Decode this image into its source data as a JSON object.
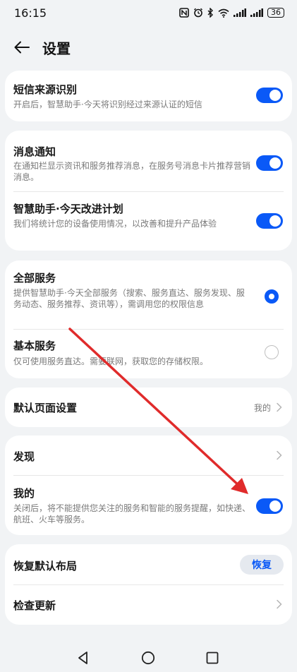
{
  "status_bar": {
    "time": "16:15",
    "icons": [
      "nfc-icon",
      "alarm-icon",
      "bluetooth-icon",
      "wifi-icon",
      "signal-icon",
      "signal-icon-2"
    ],
    "battery_level": "36"
  },
  "header": {
    "back_icon": "back-arrow-icon",
    "title": "设置"
  },
  "sms_card": {
    "title": "短信来源识别",
    "desc": "开启后，智慧助手·今天将识别经过来源认证的短信",
    "toggle_on": true
  },
  "notify_card": {
    "items": [
      {
        "title": "消息通知",
        "desc": "在通知栏显示资讯和服务推荐消息，在服务号消息卡片推荐营销消息。",
        "toggle_on": true
      },
      {
        "title": "智慧助手·今天改进计划",
        "desc": "我们将统计您的设备使用情况，以改善和提升产品体验",
        "toggle_on": true
      }
    ]
  },
  "service_card": {
    "items": [
      {
        "title": "全部服务",
        "desc": "提供智慧助手·今天全部服务（搜索、服务直达、服务发现、服务动态、服务推荐、资讯等），需调用您的权限信息",
        "selected": true
      },
      {
        "title": "基本服务",
        "desc": "仅可使用服务直达。需要联网，获取您的存储权限。",
        "selected": false
      }
    ]
  },
  "default_page_card": {
    "title": "默认页面设置",
    "value": "我的"
  },
  "tabs_card": {
    "discover": {
      "title": "发现"
    },
    "mine": {
      "title": "我的",
      "desc": "关闭后，将不能提供您关注的服务和智能的服务提醒，如快递、航班、火车等服务。",
      "toggle_on": true
    }
  },
  "layout_card": {
    "restore_title": "恢复默认布局",
    "restore_button": "恢复",
    "update_title": "检查更新"
  },
  "nav_bar": {
    "back": "nav-back-icon",
    "home": "nav-home-icon",
    "recents": "nav-recents-icon"
  },
  "colors": {
    "accent": "#0a59f7",
    "background": "#f1f3f5",
    "annotation_arrow": "#e02b2b"
  }
}
